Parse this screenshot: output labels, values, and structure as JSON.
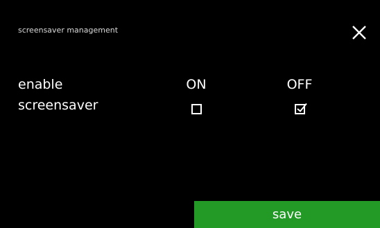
{
  "header": {
    "title": "screensaver management",
    "close_icon": "close-icon"
  },
  "setting": {
    "label_line1": "enable",
    "label_line2": "screensaver",
    "options": [
      {
        "label": "ON",
        "checked": false
      },
      {
        "label": "OFF",
        "checked": true
      }
    ]
  },
  "footer": {
    "save_label": "save"
  },
  "colors": {
    "background": "#000000",
    "text": "#ffffff",
    "save_button": "#239a26"
  }
}
